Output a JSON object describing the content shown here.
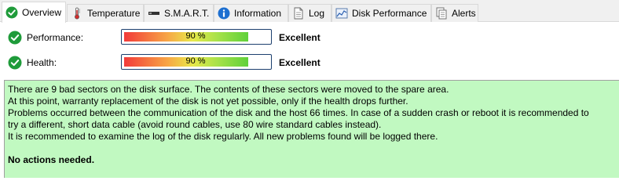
{
  "tabs": [
    {
      "label": "Overview",
      "icon": "check-circle-icon",
      "active": true
    },
    {
      "label": "Temperature",
      "icon": "thermometer-icon",
      "active": false
    },
    {
      "label": "S.M.A.R.T.",
      "icon": "drive-icon",
      "active": false
    },
    {
      "label": "Information",
      "icon": "info-icon",
      "active": false
    },
    {
      "label": "Log",
      "icon": "document-icon",
      "active": false
    },
    {
      "label": "Disk Performance",
      "icon": "chart-icon",
      "active": false
    },
    {
      "label": "Alerts",
      "icon": "alerts-icon",
      "active": false
    }
  ],
  "performance": {
    "label": "Performance:",
    "percent_text": "90 %",
    "value": 0.9,
    "rating": "Excellent"
  },
  "health": {
    "label": "Health:",
    "percent_text": "90 %",
    "value": 0.9,
    "rating": "Excellent"
  },
  "message": {
    "lines": [
      "There are 9 bad sectors on the disk surface. The contents of these sectors were moved to the spare area.",
      "At this point, warranty replacement of the disk is not yet possible, only if the health drops further.",
      "Problems occurred between the communication of the disk and the host 66 times. In case of a sudden crash or reboot it is recommended to",
      "try a different, short data cable (avoid round cables, use 80 wire standard cables instead).",
      "It is recommended to examine the log of the disk regularly. All new problems found will be logged there."
    ],
    "action": "No actions needed."
  },
  "colors": {
    "message_background": "#c1f9c1",
    "bar_border": "#1c3f6e",
    "status_ok": "#1f9b3a"
  }
}
